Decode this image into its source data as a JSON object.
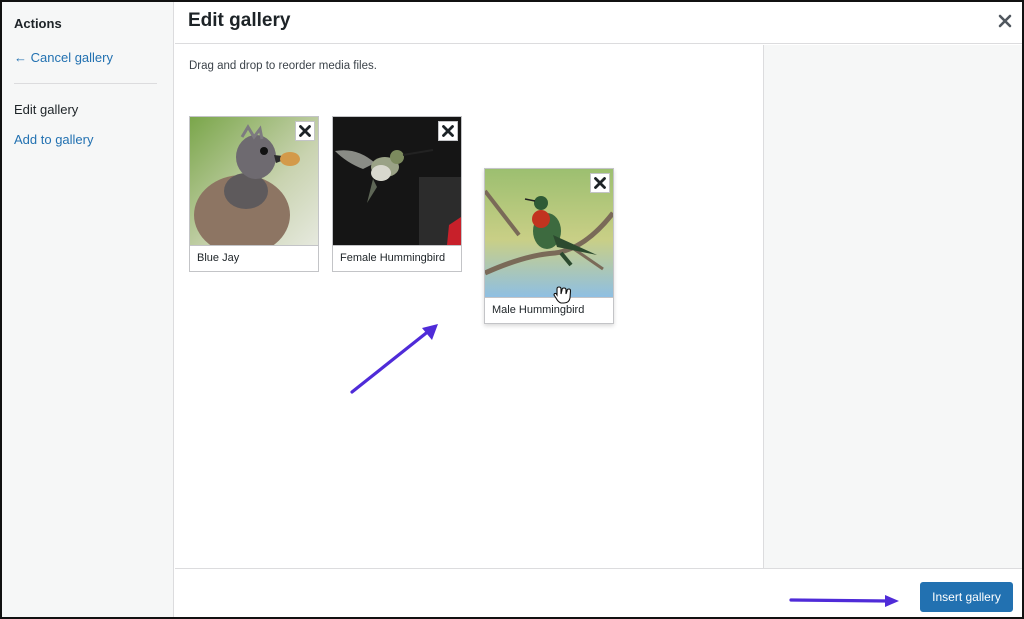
{
  "sidebar": {
    "heading": "Actions",
    "cancel_label": "← Cancel gallery",
    "current_label": "Edit gallery",
    "add_label": "Add to gallery"
  },
  "header": {
    "title": "Edit gallery",
    "close_icon": "close-icon"
  },
  "content": {
    "instructions": "Drag and drop to reorder media files.",
    "items": [
      {
        "caption": "Blue Jay"
      },
      {
        "caption": "Female Hummingbird"
      },
      {
        "caption": "Male Hummingbird"
      }
    ]
  },
  "toolbar": {
    "insert_label": "Insert gallery"
  },
  "colors": {
    "link": "#2271b1",
    "primary_button": "#2271b1",
    "annotation_arrow": "#4f2bd8",
    "sidebar_bg": "#f6f7f7"
  }
}
